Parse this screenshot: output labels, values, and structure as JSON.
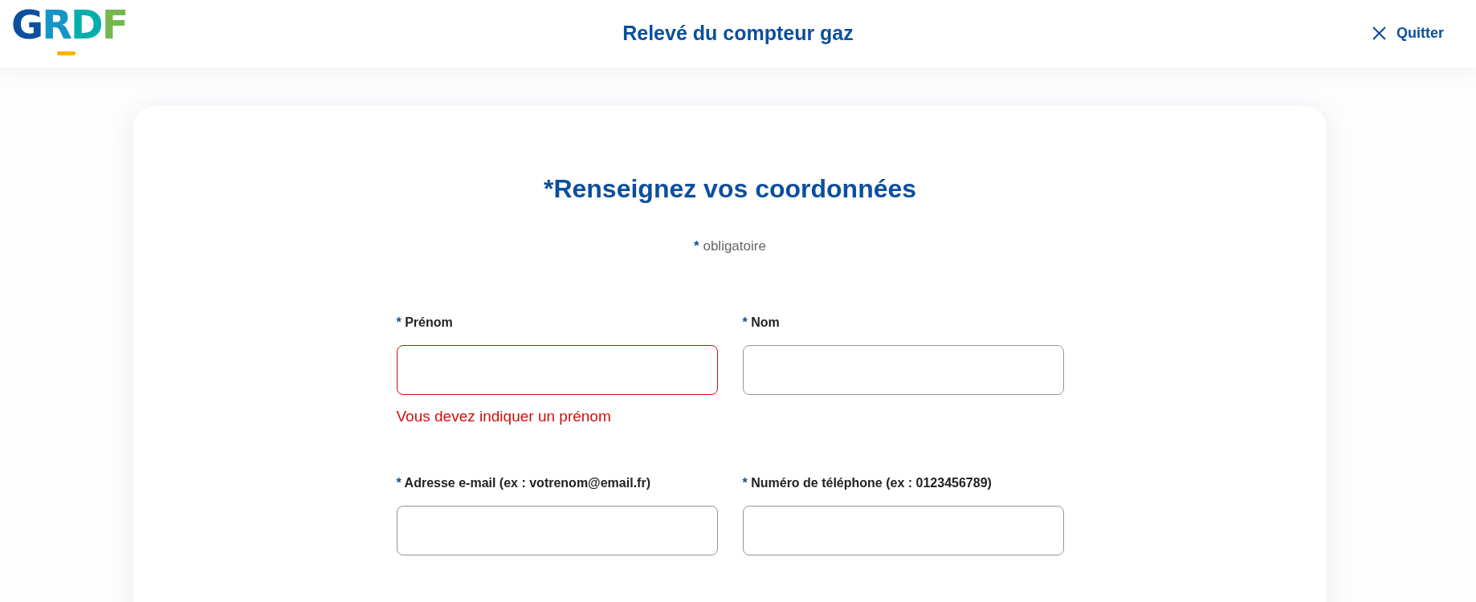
{
  "header": {
    "logo": {
      "text": "GRDF"
    },
    "title": "Relevé du compteur gaz",
    "quit_button": {
      "label": "Quitter"
    }
  },
  "form": {
    "title": "*Renseignez vos coordonnées",
    "required_note": {
      "mark": "*",
      "text": "obligatoire"
    },
    "fields": [
      {
        "mark": "*",
        "label": "Prénom",
        "invalid": true,
        "error": "Vous devez indiquer un prénom"
      },
      {
        "mark": "*",
        "label": "Nom",
        "invalid": false
      },
      {
        "mark": "*",
        "label": "Adresse e-mail (ex : votrenom@email.fr)",
        "invalid": false
      },
      {
        "mark": "*",
        "label": "Numéro de téléphone (ex : 0123456789)",
        "invalid": false
      }
    ]
  }
}
